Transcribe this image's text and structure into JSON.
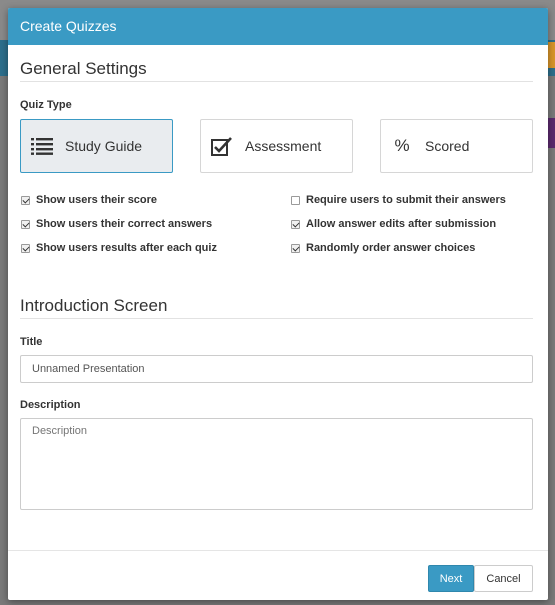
{
  "modal": {
    "title": "Create Quizzes",
    "next_label": "Next",
    "cancel_label": "Cancel"
  },
  "general": {
    "heading": "General Settings",
    "quiz_type_label": "Quiz Type",
    "types": [
      {
        "label": "Study Guide",
        "icon": "list-icon",
        "selected": true
      },
      {
        "label": "Assessment",
        "icon": "checkbox-icon",
        "selected": false
      },
      {
        "label": "Scored",
        "icon": "percent-icon",
        "selected": false
      }
    ],
    "options_left": [
      {
        "label": "Show users their score",
        "checked": true
      },
      {
        "label": "Show users their correct answers",
        "checked": true
      },
      {
        "label": "Show users results after each quiz",
        "checked": true
      }
    ],
    "options_right": [
      {
        "label": "Require users to submit their answers",
        "checked": false
      },
      {
        "label": "Allow answer edits after submission",
        "checked": true
      },
      {
        "label": "Randomly order answer choices",
        "checked": true
      }
    ]
  },
  "intro": {
    "heading": "Introduction Screen",
    "title_label": "Title",
    "title_value": "Unnamed Presentation",
    "description_label": "Description",
    "description_placeholder": "Description"
  },
  "colors": {
    "accent": "#3a9ac4"
  }
}
